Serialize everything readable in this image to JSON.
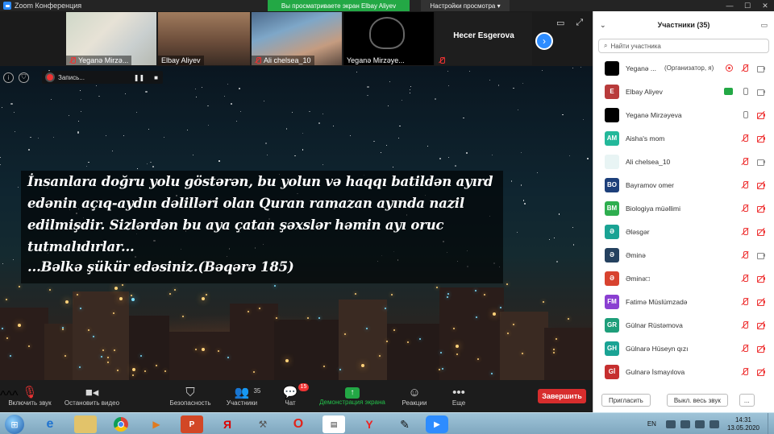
{
  "window": {
    "title": "Zoom Конференция",
    "viewing_banner": "Вы просматриваете экран Elbay Aliyev",
    "view_options": "Настройки просмотра ▾"
  },
  "video_strip": {
    "tiles": [
      {
        "name": "Yeganə Mirzə..."
      },
      {
        "name": "Elbay Aliyev"
      },
      {
        "name": "Ali chelsea_10"
      },
      {
        "name": "Yeganə Mirzəye..."
      },
      {
        "name": "Hecer Esgerova"
      }
    ]
  },
  "recording": {
    "label": "Запись...",
    "pause_label": "❚❚",
    "stop_label": "■"
  },
  "shared_screen": {
    "quote_lines": [
      "İnsanlara doğru yolu göstərən, bu yolun və haqqı batildən ayırd",
      "edənin açıq-aydın dəlilləri olan Quran ramazan ayında nazil",
      "edilmişdir. Sizlərdən bu aya çatan şəxslər həmin ayı oruc",
      "tutmalıdırlar...",
      "...Bəlkə şükür edəsiniz.(Bəqərə 185)"
    ]
  },
  "toolbar": {
    "mute_label": "Включить звук",
    "video_label": "Остановить видео",
    "security_label": "Безопасность",
    "participants_label": "Участники",
    "participants_count": "35",
    "chat_label": "Чат",
    "chat_badge": "15",
    "share_label": "Демонстрация экрана",
    "reactions_label": "Реакции",
    "more_label": "Еще",
    "end_label": "Завершить"
  },
  "participants_panel": {
    "title": "Участники (35)",
    "search_placeholder": "Найти участника",
    "invite_label": "Пригласить",
    "mute_all_label": "Выкл. весь звук",
    "more_label": "...",
    "items": [
      {
        "initials": "",
        "name": "Yeganə ...",
        "note": "(Организатор, я)",
        "color": "#000000",
        "mic": "off",
        "cam": "on",
        "extra": "rec"
      },
      {
        "initials": "E",
        "name": "Elbay Aliyev",
        "note": "",
        "color": "#b83b3b",
        "mic": "on",
        "cam": "on",
        "extra": "share"
      },
      {
        "initials": "",
        "name": "Yeganə Mirzəyeva",
        "note": "",
        "color": "#000000",
        "mic": "on",
        "cam": "off",
        "extra": ""
      },
      {
        "initials": "AM",
        "name": "Aisha's mom",
        "note": "",
        "color": "#23b89a",
        "mic": "off",
        "cam": "off",
        "extra": ""
      },
      {
        "initials": "",
        "name": "Ali chelsea_10",
        "note": "",
        "color": "#e8f4f4",
        "mic": "off",
        "cam": "on",
        "extra": ""
      },
      {
        "initials": "BO",
        "name": "Bayramov omer",
        "note": "",
        "color": "#1d3f7a",
        "mic": "off",
        "cam": "off",
        "extra": ""
      },
      {
        "initials": "BM",
        "name": "Biologiya müəllimi",
        "note": "",
        "color": "#2eae4f",
        "mic": "off",
        "cam": "off",
        "extra": ""
      },
      {
        "initials": "Ə",
        "name": "Ələsgər",
        "note": "",
        "color": "#1aa394",
        "mic": "off",
        "cam": "off",
        "extra": ""
      },
      {
        "initials": "Ə",
        "name": "Əminə",
        "note": "",
        "color": "#25415f",
        "mic": "off",
        "cam": "on",
        "extra": ""
      },
      {
        "initials": "Ə",
        "name": "Əminə□",
        "note": "",
        "color": "#d8432f",
        "mic": "off",
        "cam": "off",
        "extra": ""
      },
      {
        "initials": "FM",
        "name": "Fatimə Müslümzadə",
        "note": "",
        "color": "#8a3fd1",
        "mic": "off",
        "cam": "off",
        "extra": ""
      },
      {
        "initials": "GR",
        "name": "Gülnar Rüstəmova",
        "note": "",
        "color": "#1e9e7a",
        "mic": "off",
        "cam": "off",
        "extra": ""
      },
      {
        "initials": "GH",
        "name": "Gülnarə Hüseyn qızı",
        "note": "",
        "color": "#1aa394",
        "mic": "off",
        "cam": "off",
        "extra": ""
      },
      {
        "initials": "Gİ",
        "name": "Gulnarə İsmayılova",
        "note": "",
        "color": "#c62f2f",
        "mic": "off",
        "cam": "off",
        "extra": ""
      }
    ]
  },
  "taskbar": {
    "language": "EN",
    "time": "14:31",
    "date": "13.05.2020"
  }
}
